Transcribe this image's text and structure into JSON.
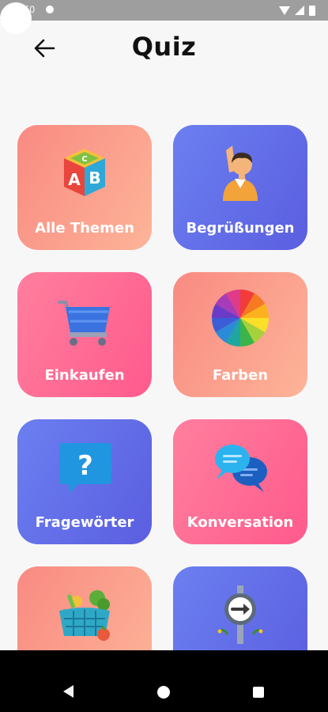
{
  "status_bar": {
    "time": "10:50"
  },
  "header": {
    "title": "Quiz"
  },
  "categories": [
    {
      "label": "Alle Themen",
      "icon": "abc-blocks-icon"
    },
    {
      "label": "Begrüßungen",
      "icon": "waving-person-icon"
    },
    {
      "label": "Einkaufen",
      "icon": "shopping-cart-icon"
    },
    {
      "label": "Farben",
      "icon": "color-wheel-icon"
    },
    {
      "label": "Fragewörter",
      "icon": "question-bubble-icon"
    },
    {
      "label": "Konversation",
      "icon": "chat-bubbles-icon"
    },
    {
      "label": "",
      "icon": "vegetable-basket-icon"
    },
    {
      "label": "",
      "icon": "direction-sign-icon"
    }
  ],
  "colors": {
    "peach": "#f98a82",
    "blue": "#5b5ee0",
    "pink": "#ff5a8c"
  }
}
